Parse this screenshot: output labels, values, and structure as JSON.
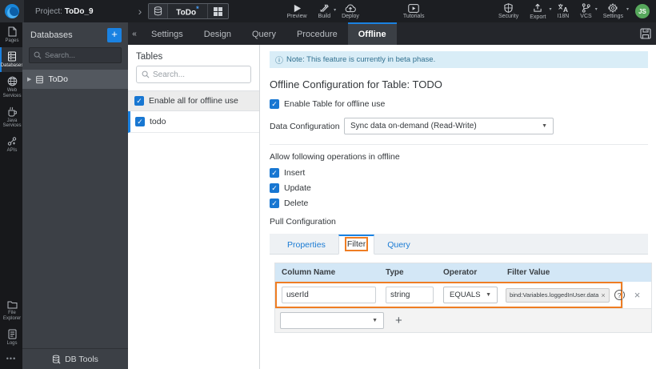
{
  "icons": {
    "chevron": "›",
    "collapse": "«",
    "caret": "▾",
    "select_caret": "▼",
    "check": "✓",
    "close": "×",
    "plus": "+",
    "dots": "•••",
    "info": "ⓘ",
    "expand": "▶",
    "question": "?"
  },
  "topbar": {
    "project_label": "Project:",
    "project_name": "ToDo_9",
    "selector_name": "ToDo",
    "modified_marker": "*",
    "preview": "Preview",
    "build": "Build",
    "deploy": "Deploy",
    "tutorials": "Tutorials",
    "security": "Security",
    "export": "Export",
    "i18n": "I18N",
    "vcs": "VCS",
    "settings": "Settings",
    "avatar_initials": "JS"
  },
  "rail": {
    "items": [
      {
        "label": "Pages"
      },
      {
        "label": "Databases",
        "active": true
      },
      {
        "label": "Web Services"
      },
      {
        "label": "Java Services"
      },
      {
        "label": "APIs"
      }
    ],
    "bottom_items": [
      {
        "label": "File Explorer"
      },
      {
        "label": "Logs"
      }
    ]
  },
  "db_panel": {
    "title": "Databases",
    "add_label": "+",
    "search_placeholder": "Search...",
    "tree_item": "ToDo",
    "footer": "DB Tools"
  },
  "main_tabs": {
    "tabs": [
      {
        "label": "Settings"
      },
      {
        "label": "Design"
      },
      {
        "label": "Query"
      },
      {
        "label": "Procedure"
      },
      {
        "label": "Offline",
        "active": true
      }
    ]
  },
  "tables_panel": {
    "title": "Tables",
    "search_placeholder": "Search...",
    "enable_all_label": "Enable all for offline use",
    "rows": [
      {
        "label": "todo",
        "checked": true,
        "selected": true
      }
    ]
  },
  "config": {
    "note": "Note: This feature is currently in beta phase.",
    "heading": "Offline Configuration for Table: TODO",
    "enable_table_label": "Enable Table for offline use",
    "data_config_label": "Data Configuration",
    "data_config_value": "Sync data on-demand (Read-Write)",
    "operations_label": "Allow following operations in offline",
    "operations": [
      "Insert",
      "Update",
      "Delete"
    ],
    "pull_config_label": "Pull Configuration",
    "pull_tabs": [
      {
        "label": "Properties"
      },
      {
        "label": "Filter",
        "active": true,
        "annotated": true
      },
      {
        "label": "Query"
      }
    ],
    "filter_table": {
      "headers": [
        "Column Name",
        "Type",
        "Operator",
        "Filter Value"
      ],
      "rows": [
        {
          "column_name": "userId",
          "type": "string",
          "operator": "EQUALS",
          "filter_value": "bind:Variables.loggedInUser.data"
        }
      ]
    }
  },
  "colors": {
    "accent_blue": "#1a82e2",
    "annotation_orange": "#ef7d23"
  }
}
